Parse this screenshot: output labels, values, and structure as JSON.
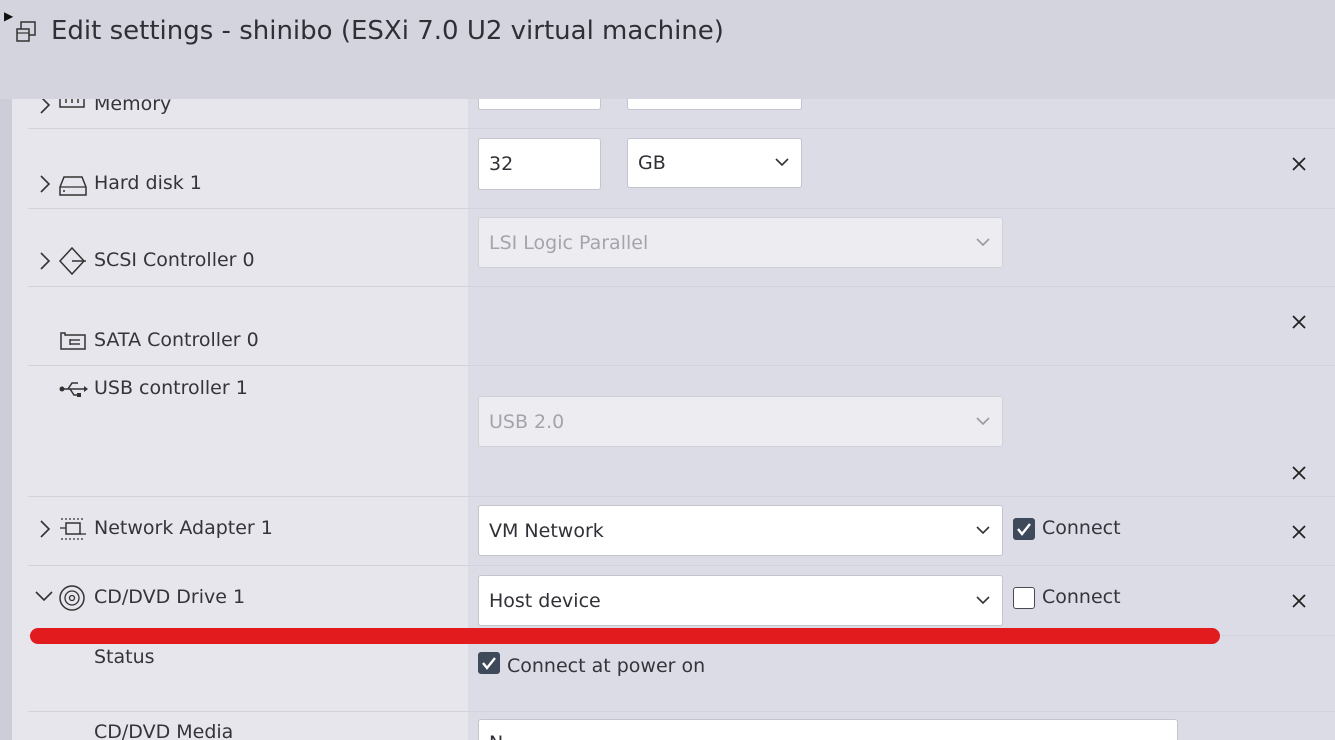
{
  "window": {
    "title": "Edit settings - shinibo (ESXi 7.0 U2 virtual machine)"
  },
  "devices": {
    "memory": {
      "label": "Memory"
    },
    "hard_disk": {
      "label": "Hard disk 1",
      "size_value": "32",
      "unit": "GB"
    },
    "scsi": {
      "label": "SCSI Controller 0",
      "type": "LSI Logic Parallel"
    },
    "sata": {
      "label": "SATA Controller 0"
    },
    "usb": {
      "label": "USB controller 1",
      "type": "USB 2.0"
    },
    "network": {
      "label": "Network Adapter 1",
      "network": "VM Network",
      "connect_label": "Connect",
      "connected": true
    },
    "cddvd": {
      "label": "CD/DVD Drive 1",
      "source": "Host device",
      "connect_label": "Connect",
      "connected": false,
      "status_label": "Status",
      "connect_at_power_on_label": "Connect at power on",
      "connect_at_power_on": true,
      "media_label": "CD/DVD Media",
      "media_value": "N"
    }
  },
  "colors": {
    "accent_annotation": "#e21c1e",
    "checkbox_checked": "#3e4a5a"
  }
}
